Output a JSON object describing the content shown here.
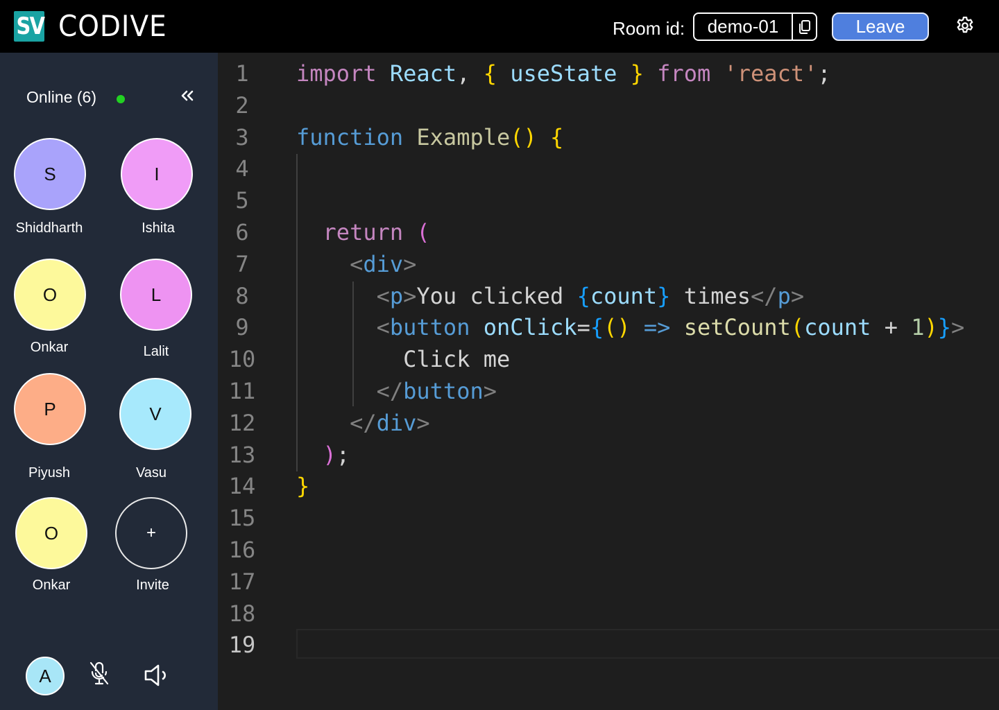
{
  "header": {
    "logo": "SV",
    "app_name": "CODIVE",
    "room_label": "Room id:",
    "room_id": "demo-01",
    "leave_label": "Leave"
  },
  "sidebar": {
    "online_label": "Online (6)",
    "participants": [
      {
        "initial": "S",
        "name": "Shiddharth",
        "color": "#a9a3fb"
      },
      {
        "initial": "I",
        "name": "Ishita",
        "color": "#f09cf7"
      },
      {
        "initial": "O",
        "name": "Onkar",
        "color": "#fdf99b"
      },
      {
        "initial": "L",
        "name": "Lalit",
        "color": "#ee93f2"
      },
      {
        "initial": "P",
        "name": "Piyush",
        "color": "#fdad87"
      },
      {
        "initial": "V",
        "name": "Vasu",
        "color": "#a7e9fc"
      },
      {
        "initial": "O",
        "name": "Onkar",
        "color": "#fdf99b"
      }
    ],
    "invite": {
      "symbol": "+",
      "label": "Invite"
    },
    "me_initial": "A"
  },
  "editor": {
    "line_numbers": [
      "1",
      "2",
      "3",
      "4",
      "5",
      "6",
      "7",
      "8",
      "9",
      "10",
      "11",
      "12",
      "13",
      "14",
      "15",
      "16",
      "17",
      "18",
      "19"
    ],
    "active_line": "19"
  }
}
